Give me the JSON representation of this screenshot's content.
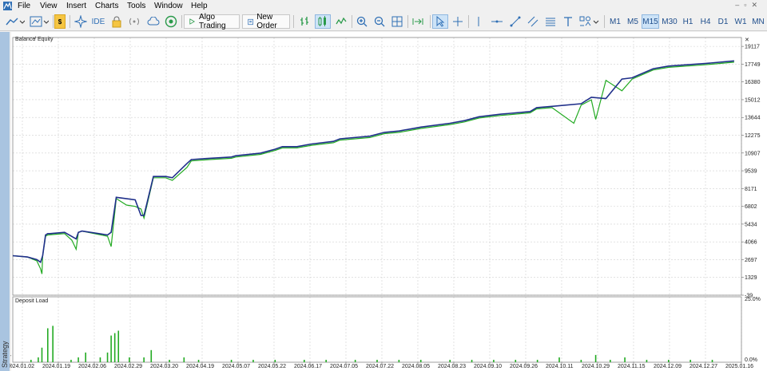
{
  "menu": {
    "items": [
      "File",
      "View",
      "Insert",
      "Charts",
      "Tools",
      "Window",
      "Help"
    ]
  },
  "toolbar": {
    "ide_label": "IDE",
    "algo_label": "Algo Trading",
    "order_label": "New Order",
    "timeframes": [
      "M1",
      "M5",
      "M15",
      "M30",
      "H1",
      "H4",
      "D1",
      "W1",
      "MN"
    ],
    "active_timeframe": "M15"
  },
  "sidebar": {
    "vertical_label": "Strategy Tester"
  },
  "colors": {
    "balance": "#1f2f8a",
    "equity": "#22aa22",
    "grid": "#d0d0d0",
    "deposit_bar": "#22aa22"
  },
  "chart_data": [
    {
      "type": "line",
      "legend": [
        "Balance",
        "Equity"
      ],
      "yticks": [
        19117,
        17749,
        16380,
        15012,
        13644,
        12275,
        10907,
        9539,
        8171,
        6802,
        5434,
        4066,
        2697,
        1329,
        -39
      ],
      "ylim": [
        -39,
        19800
      ],
      "xticks": [
        "2024.01.02",
        "2024.01.19",
        "2024.02.06",
        "2024.02.29",
        "2024.03.20",
        "2024.04.19",
        "2024.05.07",
        "2024.05.22",
        "2024.06.17",
        "2024.07.05",
        "2024.07.22",
        "2024.08.05",
        "2024.08.23",
        "2024.09.10",
        "2024.09.26",
        "2024.10.11",
        "2024.10.29",
        "2024.11.15",
        "2024.12.09",
        "2024.12.27",
        "2025.01.16"
      ],
      "series": [
        {
          "name": "Balance",
          "x": [
            0,
            0.02,
            0.033,
            0.038,
            0.041,
            0.045,
            0.048,
            0.051,
            0.071,
            0.087,
            0.09,
            0.095,
            0.13,
            0.135,
            0.142,
            0.168,
            0.176,
            0.18,
            0.193,
            0.21,
            0.219,
            0.239,
            0.245,
            0.27,
            0.3,
            0.306,
            0.34,
            0.36,
            0.37,
            0.39,
            0.41,
            0.44,
            0.449,
            0.49,
            0.51,
            0.53,
            0.56,
            0.6,
            0.62,
            0.64,
            0.67,
            0.71,
            0.719,
            0.74,
            0.78,
            0.794,
            0.814,
            0.836,
            0.85,
            0.879,
            0.9,
            0.95,
            0.99
          ],
          "y": [
            3000,
            2900,
            2700,
            2500,
            3000,
            4600,
            4700,
            4700,
            4800,
            4300,
            4800,
            4900,
            4600,
            4800,
            7500,
            7300,
            6100,
            6100,
            9100,
            9100,
            9000,
            10100,
            10400,
            10500,
            10600,
            10700,
            10900,
            11200,
            11400,
            11400,
            11600,
            11800,
            12000,
            12200,
            12500,
            12600,
            12900,
            13200,
            13400,
            13700,
            13900,
            14100,
            14400,
            14500,
            14700,
            15200,
            15100,
            16600,
            16700,
            17400,
            17600,
            17800,
            18000
          ]
        },
        {
          "name": "Equity",
          "x": [
            0,
            0.02,
            0.033,
            0.038,
            0.04,
            0.041,
            0.045,
            0.048,
            0.071,
            0.081,
            0.087,
            0.09,
            0.095,
            0.13,
            0.135,
            0.142,
            0.156,
            0.168,
            0.176,
            0.18,
            0.193,
            0.21,
            0.219,
            0.239,
            0.245,
            0.27,
            0.3,
            0.306,
            0.34,
            0.36,
            0.37,
            0.39,
            0.41,
            0.44,
            0.449,
            0.49,
            0.51,
            0.53,
            0.56,
            0.6,
            0.62,
            0.64,
            0.67,
            0.71,
            0.719,
            0.74,
            0.77,
            0.78,
            0.794,
            0.8,
            0.814,
            0.836,
            0.85,
            0.879,
            0.9,
            0.95,
            0.99
          ],
          "y": [
            3000,
            2900,
            2600,
            2000,
            1600,
            3000,
            4500,
            4600,
            4700,
            4200,
            3500,
            4800,
            4900,
            4500,
            3700,
            7400,
            6900,
            6800,
            6600,
            5900,
            9000,
            9000,
            8800,
            9800,
            10300,
            10400,
            10500,
            10600,
            10800,
            11100,
            11300,
            11300,
            11500,
            11700,
            11900,
            12100,
            12400,
            12500,
            12800,
            13100,
            13300,
            13600,
            13800,
            14000,
            14300,
            14400,
            13200,
            14600,
            15000,
            13500,
            16500,
            15700,
            16600,
            17300,
            17500,
            17700,
            17900
          ]
        }
      ]
    },
    {
      "type": "bar",
      "title": "Deposit Load",
      "yticks": [
        "25.0%",
        "0.0%"
      ],
      "ylim": [
        0,
        25
      ],
      "x": [
        0.025,
        0.035,
        0.04,
        0.048,
        0.055,
        0.08,
        0.09,
        0.1,
        0.12,
        0.13,
        0.135,
        0.14,
        0.145,
        0.16,
        0.18,
        0.19,
        0.215,
        0.235,
        0.255,
        0.3,
        0.33,
        0.36,
        0.4,
        0.43,
        0.47,
        0.5,
        0.53,
        0.56,
        0.6,
        0.63,
        0.66,
        0.69,
        0.72,
        0.75,
        0.78,
        0.8,
        0.82,
        0.84,
        0.87,
        0.9,
        0.93,
        0.96
      ],
      "values": [
        1,
        2,
        6,
        14,
        15,
        1,
        2,
        4,
        2,
        4,
        11,
        12,
        13,
        2,
        2,
        5,
        1,
        2,
        1,
        1,
        1,
        1,
        1,
        1,
        1,
        1,
        1,
        1,
        1,
        1,
        1,
        1,
        1,
        2,
        1,
        3,
        1,
        2,
        1,
        1,
        1,
        1
      ]
    }
  ]
}
